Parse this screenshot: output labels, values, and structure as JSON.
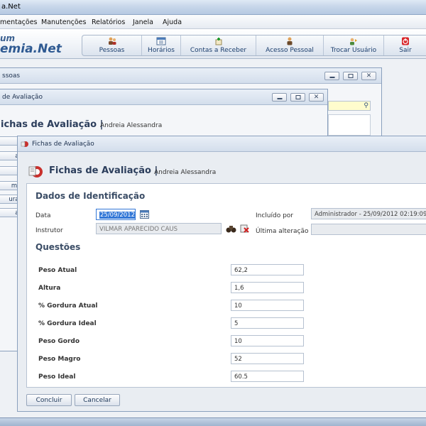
{
  "app": {
    "title": "a.Net",
    "logo_top": "um",
    "logo_bottom": "emia.Net"
  },
  "menu": [
    "mentações",
    "Manutenções",
    "Relatórios",
    "Janela",
    "Ajuda"
  ],
  "toolbar": [
    {
      "label": "Pessoas",
      "icon": "people-icon"
    },
    {
      "label": "Horários",
      "icon": "calendar-icon"
    },
    {
      "label": "Contas a Receber",
      "icon": "receivable-icon"
    },
    {
      "label": "Acesso Pessoal",
      "icon": "person-access-icon"
    },
    {
      "label": "Trocar Usuário",
      "icon": "switch-user-icon"
    },
    {
      "label": "Sair",
      "icon": "exit-icon"
    }
  ],
  "win_pessoas": {
    "title": "ssoas"
  },
  "win_mid": {
    "title": "de Avaliação",
    "heading": "ichas de Avaliação |",
    "sub": "Andreia Alessandra",
    "side_buttons": [
      "ir",
      "ar",
      "ir",
      "mir",
      "urar",
      "ar"
    ]
  },
  "win_front": {
    "title": "Fichas de Avaliação",
    "heading": "Fichas de Avaliação |",
    "sub": "Andreia Alessandra",
    "section_ident": "Dados de Identificação",
    "data_label": "Data",
    "data_value": "25/09/2012",
    "instrutor_label": "Instrutor",
    "instrutor_value": "VILMAR APARECIDO CAUS",
    "incluido_label": "Incluído por",
    "incluido_value": "Administrador - 25/09/2012 02:19:09",
    "ultima_label": "Última alteração",
    "ultima_value": "",
    "section_questoes": "Questões",
    "questions": [
      {
        "label": "Peso Atual",
        "value": "62,2"
      },
      {
        "label": "Altura",
        "value": "1,6"
      },
      {
        "label": "% Gordura Atual",
        "value": "10"
      },
      {
        "label": "% Gordura Ideal",
        "value": "5"
      },
      {
        "label": "Peso Gordo",
        "value": "10"
      },
      {
        "label": "Peso Magro",
        "value": "52"
      },
      {
        "label": "Peso Ideal",
        "value": "60.5"
      }
    ],
    "btn_concluir": "Concluir",
    "btn_cancelar": "Cancelar"
  }
}
